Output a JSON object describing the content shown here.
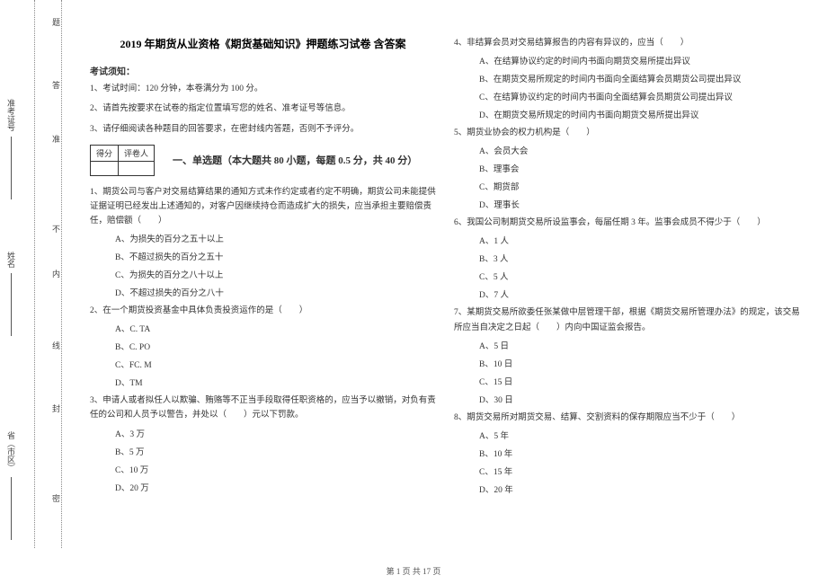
{
  "binding": {
    "mi": "密",
    "feng": "封",
    "xian": "线",
    "nei": "内",
    "bu": "不",
    "zhun": "准",
    "da": "答",
    "ti": "题",
    "field_province": "省（市区）",
    "field_name": "姓名",
    "field_ticket": "准考证号"
  },
  "header": {
    "title": "2019 年期货从业资格《期货基础知识》押题练习试卷 含答案",
    "notice_head": "考试须知：",
    "notice1": "1、考试时间：120 分钟，本卷满分为 100 分。",
    "notice2": "2、请首先按要求在试卷的指定位置填写您的姓名、准考证号等信息。",
    "notice3": "3、请仔细阅读各种题目的回答要求，在密封线内答题，否则不予评分。",
    "score_col1": "得分",
    "score_col2": "评卷人",
    "section1": "一、单选题（本大题共 80 小题，每题 0.5 分，共 40 分）"
  },
  "left": {
    "q1": "1、期货公司与客户对交易结算结果的通知方式未作约定或者约定不明确，期货公司未能提供证据证明已经发出上述通知的，对客户因继续持仓而造成扩大的损失，应当承担主要赔偿责任，赔偿额（　　）",
    "q1a": "A、为损失的百分之五十以上",
    "q1b": "B、不超过损失的百分之五十",
    "q1c": "C、为损失的百分之八十以上",
    "q1d": "D、不超过损失的百分之八十",
    "q2": "2、在一个期货投资基金中具体负责投资运作的是（　　）",
    "q2a": "A、C. TA",
    "q2b": "B、C. PO",
    "q2c": "C、FC. M",
    "q2d": "D、TM",
    "q3": "3、申请人或者拟任人以欺骗、贿赂等不正当手段取得任职资格的，应当予以撤销，对负有责任的公司和人员予以警告，并处以（　　）元以下罚款。",
    "q3a": "A、3 万",
    "q3b": "B、5 万",
    "q3c": "C、10 万",
    "q3d": "D、20 万"
  },
  "right": {
    "q4": "4、非结算会员对交易结算报告的内容有异议的，应当（　　）",
    "q4a": "A、在结算协议约定的时间内书面向期货交易所提出异议",
    "q4b": "B、在期货交易所规定的时间内书面向全面结算会员期货公司提出异议",
    "q4c": "C、在结算协议约定的时间内书面向全面结算会员期货公司提出异议",
    "q4d": "D、在期货交易所规定的时间内书面向期货交易所提出异议",
    "q5": "5、期货业协会的权力机构是（　　）",
    "q5a": "A、会员大会",
    "q5b": "B、理事会",
    "q5c": "C、期货部",
    "q5d": "D、理事长",
    "q6": "6、我国公司制期货交易所设监事会，每届任期 3 年。监事会成员不得少于（　　）",
    "q6a": "A、1 人",
    "q6b": "B、3 人",
    "q6c": "C、5 人",
    "q6d": "D、7 人",
    "q7": "7、某期货交易所欲委任张某做中层管理干部，根据《期货交易所管理办法》的规定，该交易所应当自决定之日起（　　）内向中国证监会报告。",
    "q7a": "A、5 日",
    "q7b": "B、10 日",
    "q7c": "C、15 日",
    "q7d": "D、30 日",
    "q8": "8、期货交易所对期货交易、结算、交割资料的保存期限应当不少于（　　）",
    "q8a": "A、5 年",
    "q8b": "B、10 年",
    "q8c": "C、15 年",
    "q8d": "D、20 年"
  },
  "footer": "第 1 页 共 17 页"
}
